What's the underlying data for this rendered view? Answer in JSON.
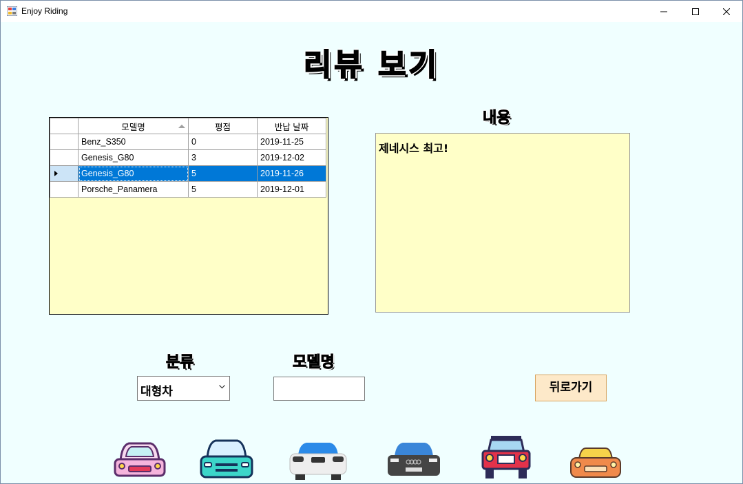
{
  "window": {
    "title": "Enjoy Riding"
  },
  "page_title": "리뷰 보기",
  "grid": {
    "columns": [
      "모델명",
      "평점",
      "반납 날짜"
    ],
    "rows": [
      {
        "model": "Benz_S350",
        "rating": "0",
        "date": "2019-11-25",
        "selected": false
      },
      {
        "model": "Genesis_G80",
        "rating": "3",
        "date": "2019-12-02",
        "selected": false
      },
      {
        "model": "Genesis_G80",
        "rating": "5",
        "date": "2019-11-26",
        "selected": true
      },
      {
        "model": "Porsche_Panamera",
        "rating": "5",
        "date": "2019-12-01",
        "selected": false
      }
    ]
  },
  "content": {
    "label": "내용",
    "text": "제네시스 최고!"
  },
  "category": {
    "label": "분류",
    "selected": "대형차"
  },
  "model_name": {
    "label": "모델명",
    "value": ""
  },
  "back_button": {
    "label": "뒤로가기"
  },
  "car_icons": [
    "car-purple-icon",
    "car-teal-icon",
    "car-blue-white-icon",
    "car-audi-icon",
    "car-red-jeep-icon",
    "car-orange-icon"
  ],
  "colors": {
    "background": "#f0ffff",
    "grid_fill": "#ffffc8",
    "selected_row": "#0078d7",
    "button_fill": "#fde9c9",
    "button_border": "#d7a35e"
  }
}
